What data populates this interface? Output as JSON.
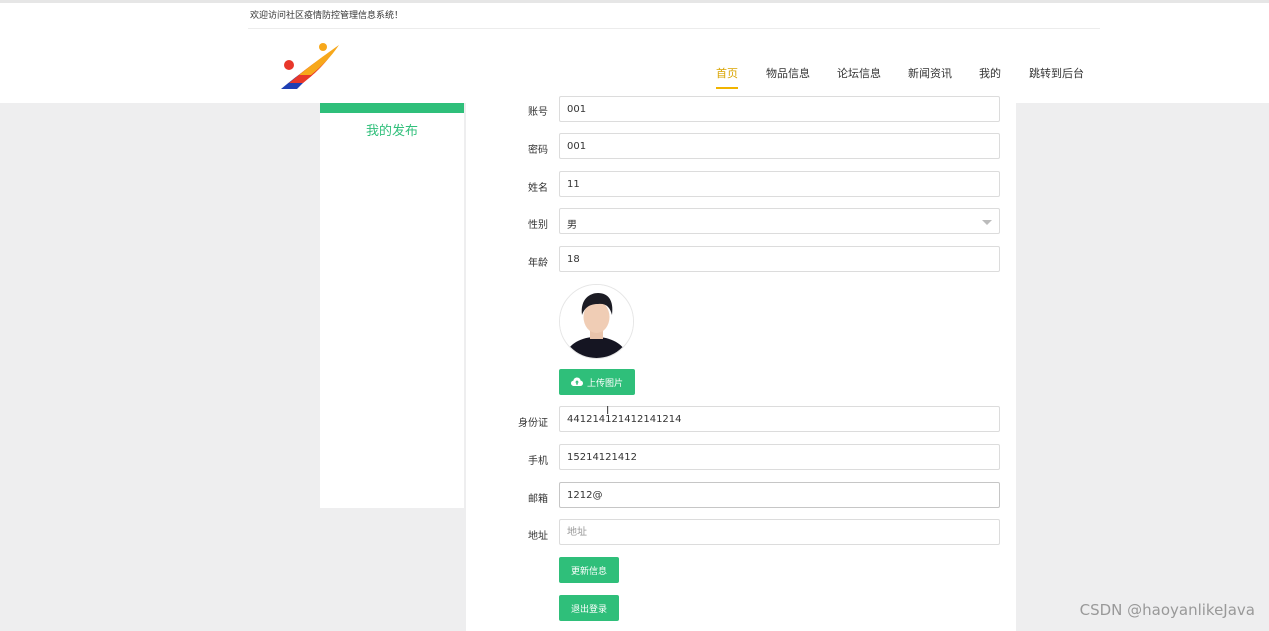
{
  "header": {
    "welcome": "欢迎访问社区疫情防控管理信息系统！",
    "nav": [
      {
        "label": "首页",
        "active": true
      },
      {
        "label": "物品信息"
      },
      {
        "label": "论坛信息"
      },
      {
        "label": "新闻资讯"
      },
      {
        "label": "我的"
      },
      {
        "label": "跳转到后台"
      }
    ]
  },
  "sidebar": {
    "items": [
      {
        "label": "我的发布"
      }
    ]
  },
  "form": {
    "account_label": "账号",
    "account_value": "001",
    "password_label": "密码",
    "password_value": "001",
    "name_label": "姓名",
    "name_value": "11",
    "gender_label": "性别",
    "gender_value": "男",
    "age_label": "年龄",
    "age_value": "18",
    "upload_label": "上传图片",
    "id_label": "身份证",
    "id_value": "441214121412141214",
    "phone_label": "手机",
    "phone_value": "15214121412",
    "email_label": "邮箱",
    "email_value": "1212@",
    "address_label": "地址",
    "address_placeholder": "地址",
    "update_label": "更新信息",
    "logout_label": "退出登录"
  },
  "watermark": "CSDN @haoyanlikeJava",
  "colors": {
    "accent_green": "#2fbf7a",
    "nav_active": "#d9a400"
  }
}
